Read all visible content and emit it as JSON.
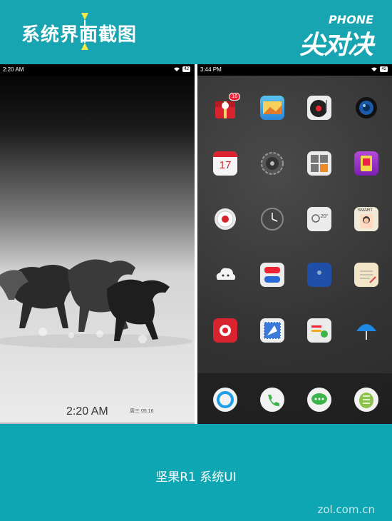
{
  "header": {
    "title": "系统界面截图",
    "logo_top": "PHONE",
    "logo_main": "尖对决"
  },
  "left_phone": {
    "status_time": "2:20 AM",
    "battery": "42",
    "lock_time": "2:20 AM",
    "lock_date": "周三 05.16"
  },
  "right_phone": {
    "status_time": "3:44 PM",
    "battery": "42",
    "badge": "16",
    "calendar_day": "17",
    "weather_temp": "20°",
    "smart_label": "SMART"
  },
  "caption": "坚果R1 系统UI",
  "watermark": "zol.com.cn",
  "icons": [
    "gift-icon",
    "photos-icon",
    "music-player-icon",
    "camera-icon",
    "calendar-icon",
    "settings-icon",
    "calculator-icon",
    "app-store-icon",
    "recorder-icon",
    "clock-icon",
    "weather-icon",
    "contacts-icon",
    "cloud-icon",
    "pills-icon",
    "notes-book-icon",
    "notepad-icon",
    "video-icon",
    "mail-stamp-icon",
    "messages-icon",
    "umbrella-icon"
  ],
  "dock_icons": [
    "browser-icon",
    "phone-icon",
    "chat-icon",
    "robot-icon"
  ]
}
